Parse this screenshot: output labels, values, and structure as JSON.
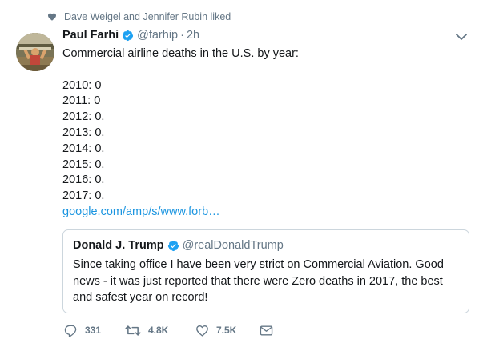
{
  "social_context": {
    "text": "Dave Weigel and Jennifer Rubin liked",
    "icon": "heart-icon"
  },
  "tweet": {
    "author_name": "Paul Farhi",
    "handle": "@farhip",
    "separator": "·",
    "time": "2h",
    "text_lines": [
      "Commercial airline deaths in the U.S. by year:",
      "",
      "2010: 0",
      "2011: 0",
      "2012: 0.",
      "2013: 0.",
      "2014: 0.",
      "2015: 0.",
      "2016: 0.",
      "2017: 0."
    ],
    "link": "google.com/amp/s/www.forb…"
  },
  "quote": {
    "author_name": "Donald J. Trump",
    "handle": "@realDonaldTrump",
    "text": "Since taking office I have been very strict on Commercial Aviation. Good news - it was just reported that there were Zero deaths in 2017, the best and safest year on record!"
  },
  "actions": {
    "reply_count": "331",
    "retweet_count": "4.8K",
    "like_count": "7.5K"
  },
  "colors": {
    "accent": "#1b95e0",
    "muted": "#657786",
    "border": "#ccd6dd",
    "text": "#14171a"
  }
}
